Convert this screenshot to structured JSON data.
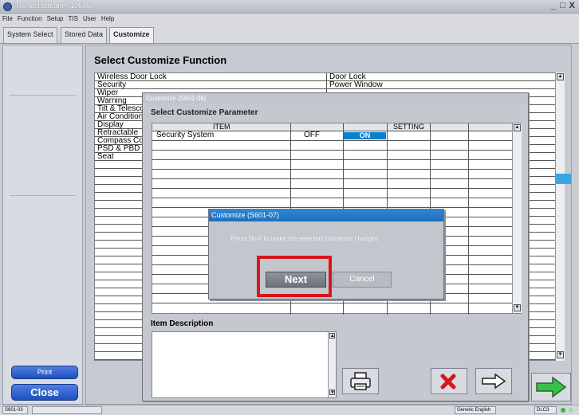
{
  "window": {
    "title": "TIS techstream - 10646",
    "controls": "_ □ X"
  },
  "menu": [
    "File",
    "Function",
    "Setup",
    "TIS",
    "User",
    "Help"
  ],
  "tabs": [
    "System Select",
    "Stored Data",
    "Customize"
  ],
  "left_panel": {
    "print_label": "Print",
    "close_label": "Close"
  },
  "main": {
    "title": "Select Customize Function",
    "functions_col1": [
      "Wireless Door Lock",
      "Security",
      "Wiper",
      "Warning",
      "Tilt & Telesco",
      "Air Condition",
      "Display",
      "Retractable",
      "Compass Co",
      "PSD & PBD",
      "Seat"
    ],
    "functions_col2": [
      "Door Lock",
      "Power Window"
    ]
  },
  "dialog_param": {
    "title": "Customize (S601-06)",
    "heading": "Select Customize Parameter",
    "col_item": "ITEM",
    "col_setting": "SETTING",
    "row_item": "Security System",
    "row_current": "OFF",
    "row_selected": "ON",
    "description_label": "Item Description"
  },
  "dialog_confirm": {
    "title": "Customize (S601-07)",
    "message": "Press Next to make the selected customize changes",
    "next_label": "Next",
    "cancel_label": "Cancel"
  },
  "status": {
    "screen_id": "S601-03",
    "language": "Generic English",
    "connection": "DLC3"
  },
  "colors": {
    "highlight": "#d9141c",
    "selected": "#0c7fd0",
    "accent_blue": "#1e4fbf"
  },
  "icons": [
    "printer-icon",
    "cancel-x-icon",
    "arrow-right-icon",
    "next-arrow-green-icon"
  ]
}
